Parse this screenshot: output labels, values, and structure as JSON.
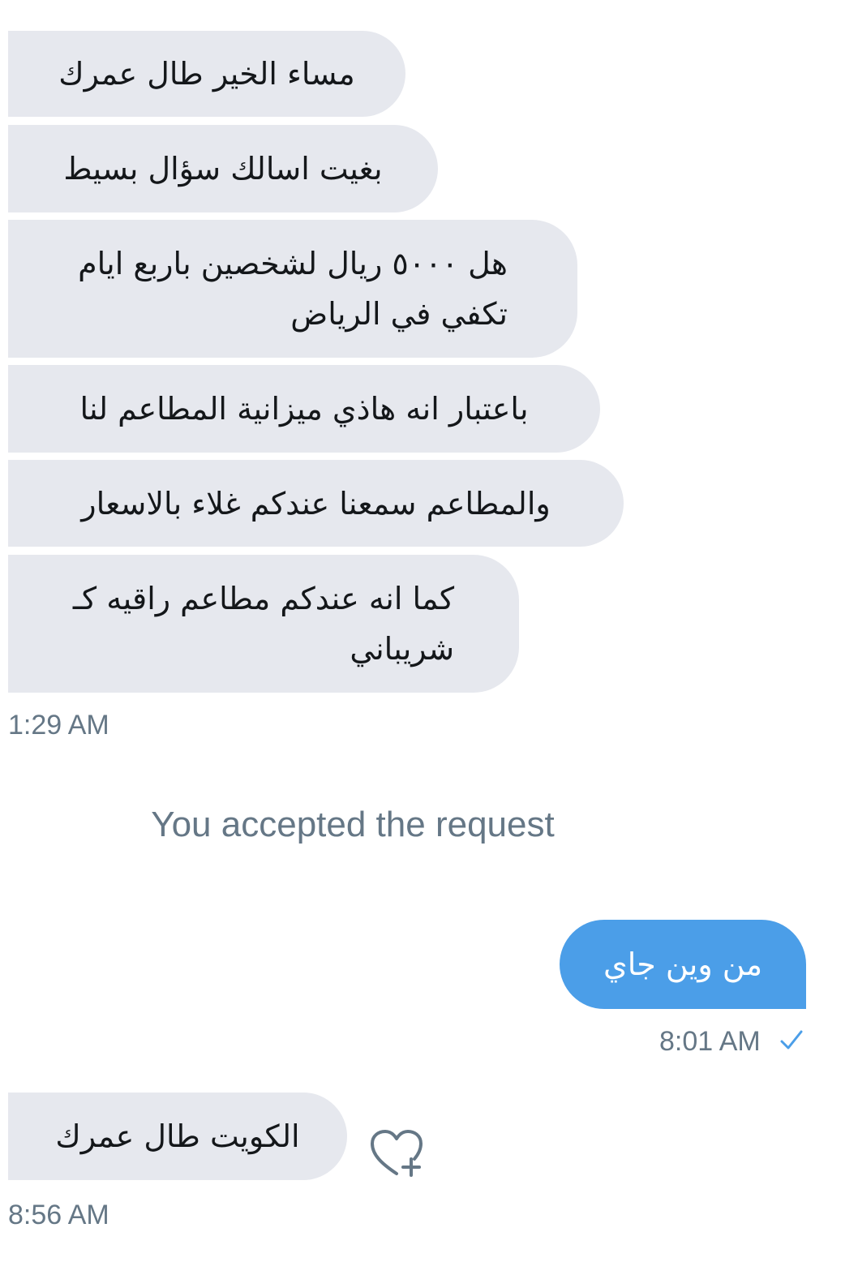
{
  "conversation": {
    "messages_group_1": [
      {
        "text": "مساء الخير طال عمرك"
      },
      {
        "text": "بغيت اسالك سؤال بسيط"
      },
      {
        "text": "هل ٥٠٠٠ ريال لشخصين باربع ايام\nتكفي في الرياض"
      },
      {
        "text": "باعتبار انه هاذي ميزانية المطاعم لنا"
      },
      {
        "text": "والمطاعم سمعنا عندكم غلاء بالاسعار"
      },
      {
        "text": "كما انه عندكم مطاعم راقيه كـ\nشريباني"
      }
    ],
    "time_1": "1:29 AM",
    "system_message": "You accepted the request",
    "outgoing_message": "من وين جاي",
    "time_2": "8:01 AM",
    "last_message": "الكويت طال عمرك",
    "time_3": "8:56 AM"
  },
  "icons": {
    "read_status": "checkmark-icon",
    "react": "heart-plus-icon"
  },
  "colors": {
    "incoming_bubble": "#e6e8ee",
    "outgoing_bubble": "#4b9ee8",
    "timestamp": "#657786",
    "check": "#4b9ee8"
  }
}
